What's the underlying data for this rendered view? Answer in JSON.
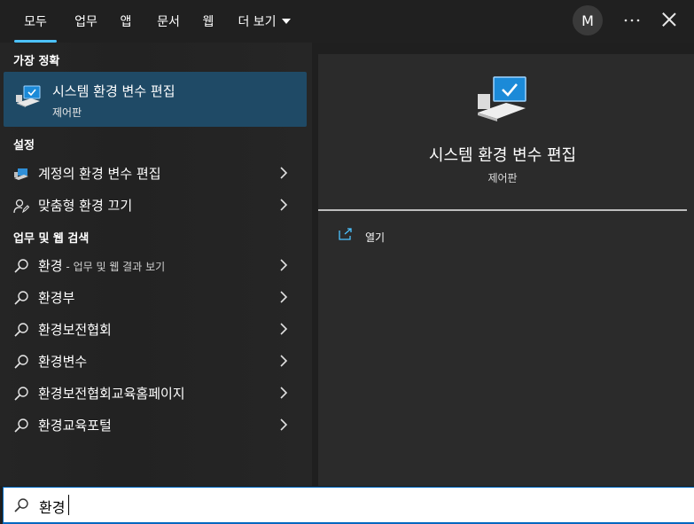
{
  "tabs": [
    {
      "label": "모두",
      "active": true
    },
    {
      "label": "업무"
    },
    {
      "label": "앱"
    },
    {
      "label": "문서"
    },
    {
      "label": "웹"
    },
    {
      "label": "더 보기",
      "has_caret": true
    }
  ],
  "header": {
    "avatar_initial": "M",
    "more_icon": "ellipsis-icon",
    "close_icon": "close-icon"
  },
  "best_match": {
    "section_label": "가장 정확",
    "title": "시스템 환경 변수 편집",
    "subtitle": "제어판",
    "icon": "monitor-check-icon"
  },
  "settings": {
    "section_label": "설정",
    "items": [
      {
        "label": "계정의 환경 변수 편집",
        "icon": "laptop-icon"
      },
      {
        "label": "맞춤형 환경 끄기",
        "icon": "person-edit-icon"
      }
    ]
  },
  "web_search": {
    "section_label": "업무 및 웹 검색",
    "items": [
      {
        "label": "환경",
        "suffix": " - 업무 및 웹 결과 보기"
      },
      {
        "label": "환경부"
      },
      {
        "label": "환경보전협회"
      },
      {
        "label": "환경변수"
      },
      {
        "label": "환경보전협회교육홈페이지"
      },
      {
        "label": "환경교육포털"
      }
    ]
  },
  "details": {
    "title": "시스템 환경 변수 편집",
    "subtitle": "제어판",
    "actions": [
      {
        "label": "열기",
        "icon": "open-external-icon"
      }
    ]
  },
  "search": {
    "value": "환경",
    "icon": "search-icon"
  },
  "colors": {
    "accent": "#4cc2ff",
    "selection": "#1f4a66",
    "search_border": "#0067c0"
  }
}
